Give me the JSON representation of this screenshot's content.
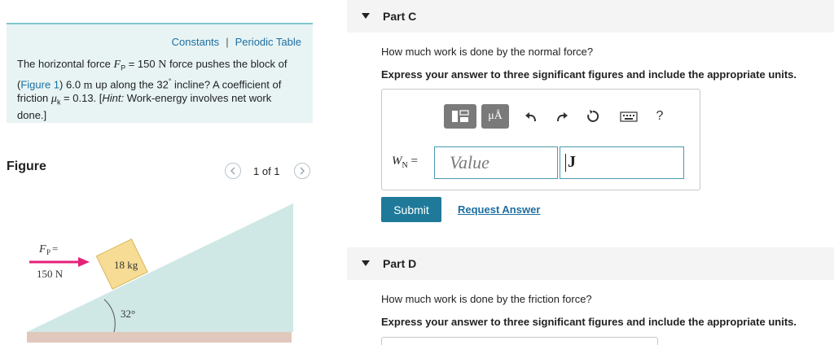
{
  "links": {
    "constants": "Constants",
    "separator": "|",
    "periodic_table": "Periodic Table"
  },
  "problem": {
    "intro": "The horizontal force ",
    "fp_symbol": "F",
    "fp_sub": "P",
    "eq1": " = 150 ",
    "unit_n": "N",
    "mid1": " force pushes the block of (",
    "figure_link": "Figure 1",
    "mid2": ") 6.0 ",
    "unit_m": "m",
    "mid3": " up along the 32",
    "deg": "°",
    "mid4": " incline? A coefficient of friction ",
    "mu_symbol": "μ",
    "mu_sub": "k",
    "eq2": " = 0.13. [",
    "hint": "Hint:",
    "hint_text": " Work-energy involves net work done.]"
  },
  "figure": {
    "title": "Figure",
    "prev_icon": "chevron-left-icon",
    "next_icon": "chevron-right-icon",
    "page_indicator": "1 of 1",
    "force_label": "F",
    "force_sub": "P",
    "force_eq": " =",
    "force_value": "150 N",
    "block_label": "18 kg",
    "angle_label": "32°",
    "colors": {
      "incline": "#cfe8e6",
      "floor": "#e0c8bc",
      "block": "#f6dc94",
      "arrow": "#e6217a"
    }
  },
  "part_c": {
    "label": "Part C",
    "question": "How much work is done by the normal force?",
    "instruction": "Express your answer to three significant figures and include the appropriate units.",
    "toolbar": {
      "templates_icon": "templates-icon",
      "mu_label": "μÅ",
      "undo_icon": "undo-icon",
      "redo_icon": "redo-icon",
      "reset_icon": "reset-icon",
      "keyboard_icon": "keyboard-icon",
      "help_label": "?"
    },
    "var_label": "W",
    "var_sub": "N",
    "var_eq": " =",
    "value_placeholder": "Value",
    "unit_value": "J",
    "submit_label": "Submit",
    "request_label": "Request Answer"
  },
  "part_d": {
    "label": "Part D",
    "question": "How much work is done by the friction force?",
    "instruction": "Express your answer to three significant figures and include the appropriate units."
  },
  "colors": {
    "accent": "#1f7a9a",
    "link": "#1d6ea0",
    "info_bg": "#e8f4f4",
    "input_border": "#4a9ab0"
  }
}
